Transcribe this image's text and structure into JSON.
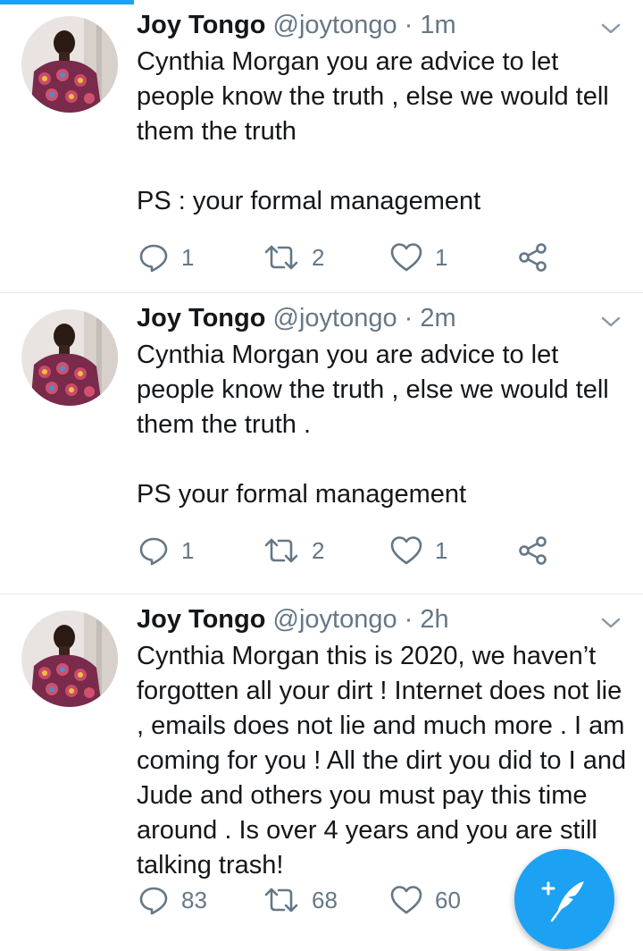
{
  "colors": {
    "accent": "#1da1f2",
    "secondary_text": "#657786",
    "primary_text": "#14171a",
    "divider": "#e1e8ed"
  },
  "tweets": [
    {
      "display_name": "Joy Tongo",
      "handle": "@joytongo",
      "separator": "·",
      "time": "1m",
      "text": "Cynthia Morgan you are advice to let people know the truth , else we would tell them the truth\n\nPS : your formal management",
      "replies": "1",
      "retweets": "2",
      "likes": "1"
    },
    {
      "display_name": "Joy Tongo",
      "handle": "@joytongo",
      "separator": "·",
      "time": "2m",
      "text": "Cynthia Morgan you are advice to let people know the truth , else we would tell them the truth .\n\nPS your formal management",
      "replies": "1",
      "retweets": "2",
      "likes": "1"
    },
    {
      "display_name": "Joy Tongo",
      "handle": "@joytongo",
      "separator": "·",
      "time": "2h",
      "text": "Cynthia Morgan this is 2020, we haven’t forgotten all your dirt ! Internet does not lie , emails does not lie and much more . I am coming for you ! All the dirt you did to I and Jude and others you must pay this time around . Is over 4 years and you are still talking trash!",
      "replies": "83",
      "retweets": "68",
      "likes": "60"
    }
  ],
  "icons": {
    "reply": "reply-icon",
    "retweet": "retweet-icon",
    "like": "heart-icon",
    "share": "share-icon",
    "caret": "chevron-down-icon",
    "compose": "compose-tweet-icon"
  }
}
